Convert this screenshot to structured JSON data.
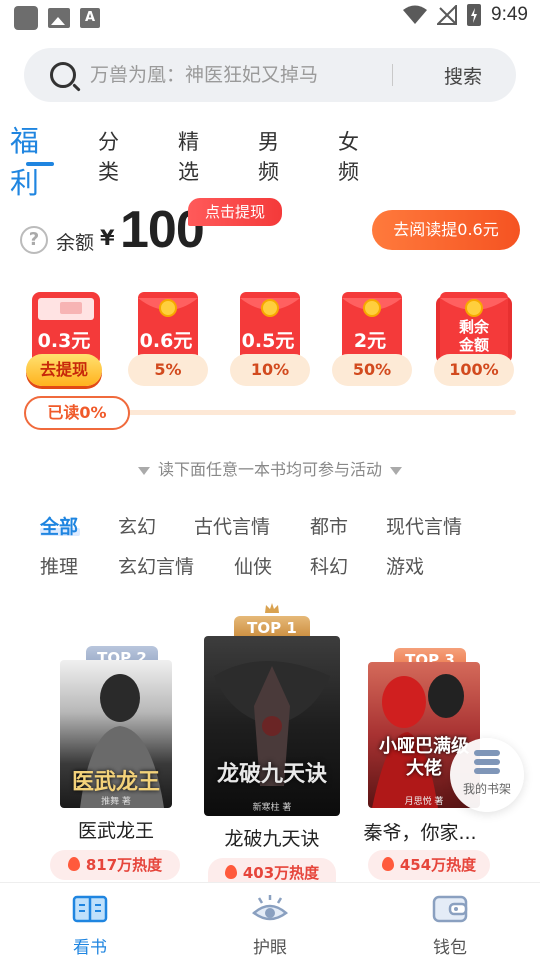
{
  "status_bar": {
    "time": "9:49"
  },
  "search": {
    "placeholder": "万兽为凰：神医狂妃又掉马",
    "button_label": "搜索"
  },
  "tabs": [
    {
      "label": "福利",
      "active": true
    },
    {
      "label": "分类",
      "active": false
    },
    {
      "label": "精选",
      "active": false
    },
    {
      "label": "男频",
      "active": false
    },
    {
      "label": "女频",
      "active": false
    }
  ],
  "balance": {
    "label": "余额",
    "currency": "¥",
    "amount": "100",
    "withdraw_tag": "点击提现",
    "read_button": "去阅读提0.6元"
  },
  "envelopes": [
    {
      "amount": "0.3元",
      "progress_label": "去提现"
    },
    {
      "amount": "0.6元",
      "progress_label": "5%"
    },
    {
      "amount": "0.5元",
      "progress_label": "10%"
    },
    {
      "amount": "2元",
      "progress_label": "50%"
    },
    {
      "amount": "剩余金额",
      "progress_label": "100%"
    }
  ],
  "read_progress": {
    "label": "已读0%",
    "fraction": 0
  },
  "hint": "读下面任意一本书均可参与活动",
  "categories": [
    "全部",
    "玄幻",
    "古代言情",
    "都市",
    "现代言情",
    "推理",
    "玄幻言情",
    "仙侠",
    "科幻",
    "游戏"
  ],
  "books": [
    {
      "rank": "TOP 2",
      "title": "医武龙王",
      "cover_title": "医武龙王",
      "cover_author": "推舞 著",
      "heat": "817万热度"
    },
    {
      "rank": "TOP 1",
      "title": "龙破九天诀",
      "cover_title": "龙破九天诀",
      "cover_author": "新寒柱 著",
      "heat": "403万热度"
    },
    {
      "rank": "TOP 3",
      "title": "秦爷，你家...",
      "cover_title": "小哑巴满级大佬",
      "cover_author": "月思悦 著",
      "heat": "454万热度"
    }
  ],
  "shelf": {
    "label": "我的书架"
  },
  "bottom_nav": [
    {
      "label": "看书",
      "icon": "book-icon",
      "active": true
    },
    {
      "label": "护眼",
      "icon": "eye-icon",
      "active": false
    },
    {
      "label": "钱包",
      "icon": "wallet-icon",
      "active": false
    }
  ],
  "colors": {
    "accent": "#1f85e0",
    "red": "#f43a3a",
    "orange": "#f55322"
  }
}
